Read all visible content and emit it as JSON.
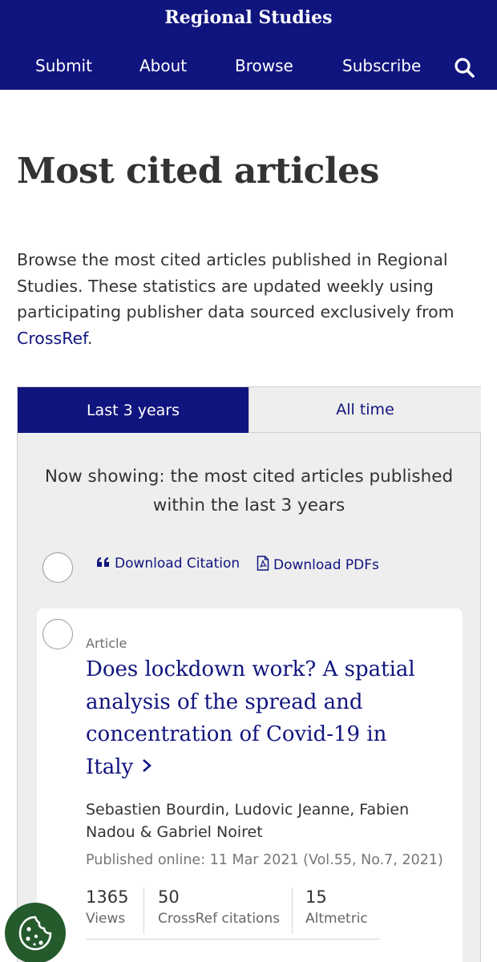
{
  "header": {
    "journal_title": "Regional Studies",
    "nav": [
      "Submit",
      "About",
      "Browse",
      "Subscribe"
    ],
    "search_icon": "search-icon",
    "background": "#10147e"
  },
  "page": {
    "title": "Most cited articles",
    "intro_text": "Browse the most cited articles published in Regional Studies. These statistics are updated weekly using participating publisher data sourced exclusively from ",
    "intro_link": "CrossRef",
    "intro_end": "."
  },
  "tabs": {
    "active": "Last 3 years",
    "inactive": "All time"
  },
  "listing": {
    "now_showing": "Now showing: the most cited articles published within the last 3 years",
    "download_citation": "Download Citation",
    "download_pdfs": "Download PDFs"
  },
  "article": {
    "type": "Article",
    "title": "Does lockdown work? A spatial analysis of the spread and concentration of Covid-19 in Italy",
    "authors": "Sebastien Bourdin, Ludovic Jeanne, Fabien Nadou & Gabriel Noiret",
    "published": "Published online: 11 Mar 2021 (Vol.55, No.7, 2021)",
    "metrics": [
      {
        "value": "1365",
        "label": "Views"
      },
      {
        "value": "50",
        "label": "CrossRef citations"
      },
      {
        "value": "15",
        "label": "Altmetric"
      }
    ]
  },
  "colors": {
    "brand": "#10147e",
    "cookie": "#245a2c",
    "panel": "#eeeeee"
  }
}
